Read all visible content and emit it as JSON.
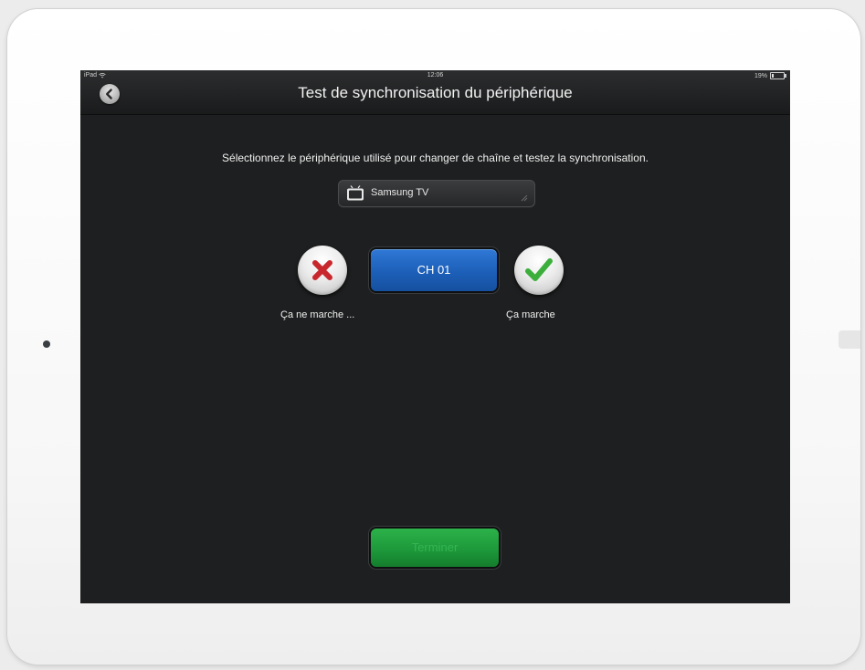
{
  "status_bar": {
    "device": "iPad",
    "time": "12:06",
    "battery": "19%",
    "battery_level": 0.19
  },
  "navbar": {
    "title": "Test de synchronisation du périphérique",
    "back_icon": "chevron-left-icon"
  },
  "instruction": "Sélectionnez le périphérique utilisé pour changer de chaîne et testez la synchronisation.",
  "device_select": {
    "icon": "tv-icon",
    "value": "Samsung TV"
  },
  "sync_test": {
    "no_label": "Ça ne marche ...",
    "channel_label": "CH 01",
    "yes_label": "Ça marche"
  },
  "finish_button": {
    "label": "Terminer"
  },
  "colors": {
    "screen_bg": "#1e1f20",
    "channel_blue": "#1c5fb8",
    "finish_green": "#1c9639",
    "cross_red": "#c8282d",
    "check_green": "#3cae3c"
  }
}
